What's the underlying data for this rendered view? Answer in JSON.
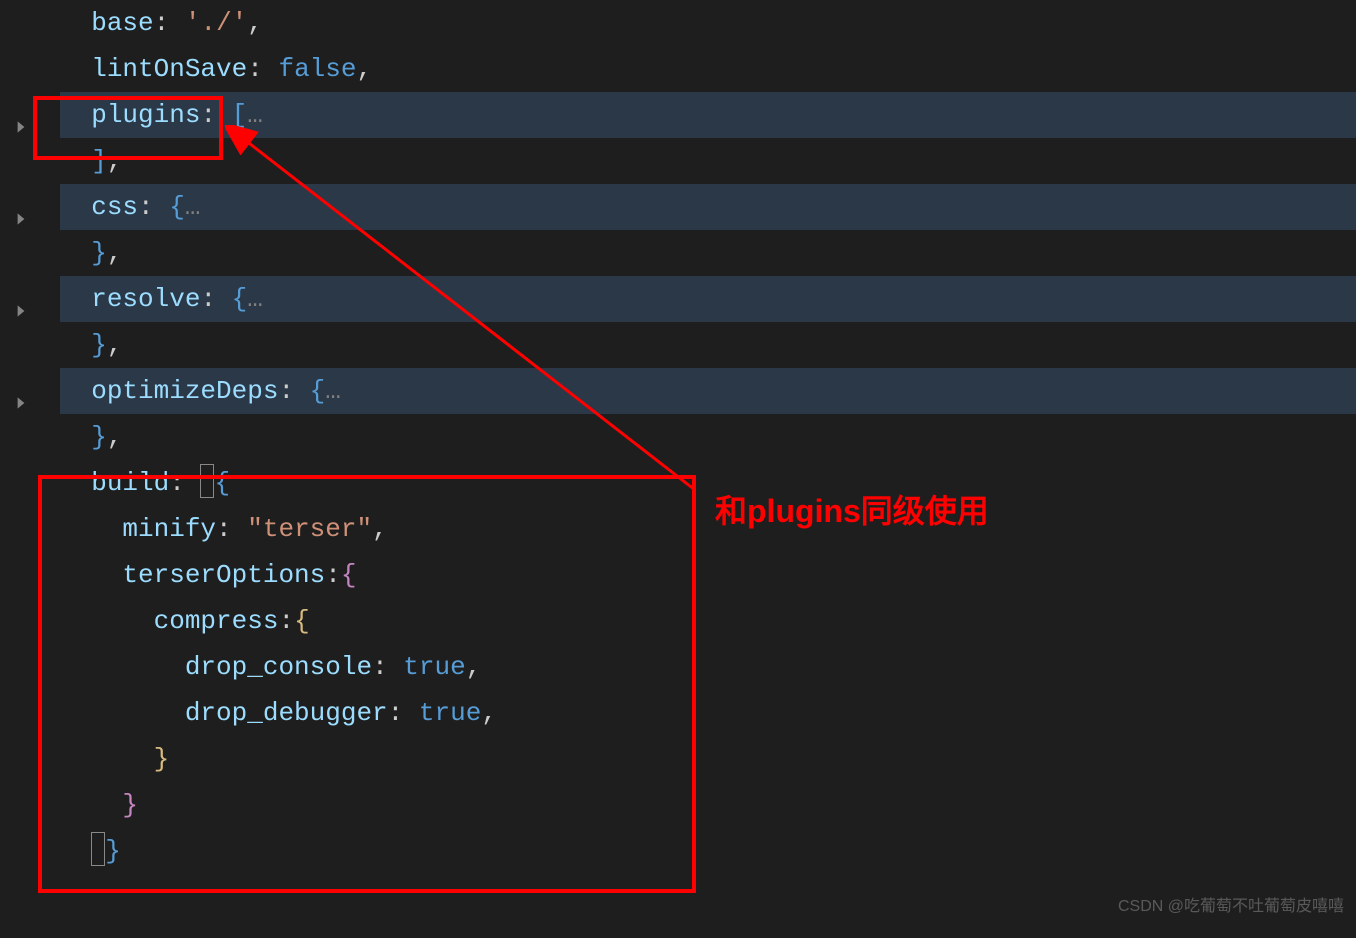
{
  "code": {
    "l1_key": "base",
    "l1_val": "'./'",
    "l2_key": "lintOnSave",
    "l2_val": "false",
    "l3_key": "plugins",
    "l5_key": "css",
    "l7_key": "resolve",
    "l9_key": "optimizeDeps",
    "l11_key": "build",
    "l12_key": "minify",
    "l12_val": "\"terser\"",
    "l13_key": "terserOptions",
    "l14_key": "compress",
    "l15_key": "drop_console",
    "l15_val": "true",
    "l16_key": "drop_debugger",
    "l16_val": "true",
    "ellipsis": "…",
    "colon": ":",
    "comma": ",",
    "lb_sq": "[",
    "rb_sq": "]",
    "lb_cu": "{",
    "rb_cu": "}"
  },
  "annotation": "和plugins同级使用",
  "watermark": "CSDN @吃葡萄不吐葡萄皮嘻嘻"
}
